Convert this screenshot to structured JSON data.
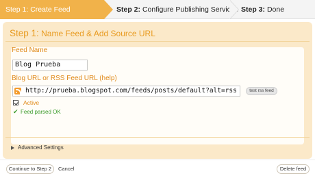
{
  "steps": {
    "step1": "Step 1: Create Feed",
    "step2_prefix": "Step 2:",
    "step2_text": "Configure Publishing Services",
    "step3_prefix": "Step 3:",
    "step3_text": "Done"
  },
  "panel": {
    "title_step": "Step 1:",
    "title_text": "Name Feed & Add Source URL"
  },
  "form": {
    "feed_name_label": "Feed Name",
    "feed_name_value": "Blog Prueba",
    "source_url_label": "Blog URL or RSS Feed URL (help)",
    "source_url_value": "http://prueba.blogspot.com/feeds/posts/default?alt=rss",
    "test_button": "test rss feed",
    "active_label": "Active",
    "active_checked": true,
    "status_message": "Feed parsed OK"
  },
  "advanced": {
    "label": "Advanced Settings"
  },
  "actions": {
    "continue": "Continue to Step 2",
    "cancel": "Cancel",
    "delete": "Delete feed"
  },
  "colors": {
    "accent": "#f1b24a",
    "panel_bg": "#fbe9c9",
    "label": "#e08a1a",
    "success": "#3a9b2a"
  }
}
